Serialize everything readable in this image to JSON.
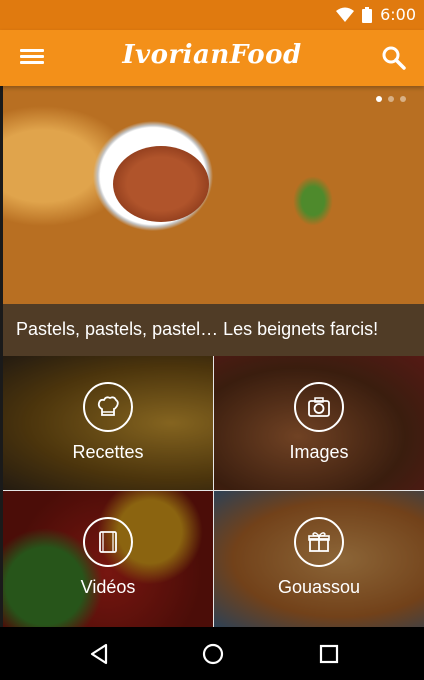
{
  "status_bar": {
    "time": "6:00",
    "icons": [
      "wifi-icon",
      "battery-icon"
    ]
  },
  "app_bar": {
    "title": "IvorianFood",
    "menu_icon": "menu-icon",
    "search_icon": "search-icon",
    "color": "#f39019"
  },
  "hero": {
    "caption": "Pastels, pastels, pastel… Les beignets farcis!",
    "pages": 3,
    "active_page": 1
  },
  "tiles": [
    {
      "label": "Recettes",
      "icon": "chef-hat-icon"
    },
    {
      "label": "Images",
      "icon": "camera-icon"
    },
    {
      "label": "Vidéos",
      "icon": "video-icon"
    },
    {
      "label": "Gouassou",
      "icon": "gift-icon"
    }
  ],
  "nav_bar": {
    "buttons": [
      "back-icon",
      "home-icon",
      "recents-icon"
    ]
  }
}
